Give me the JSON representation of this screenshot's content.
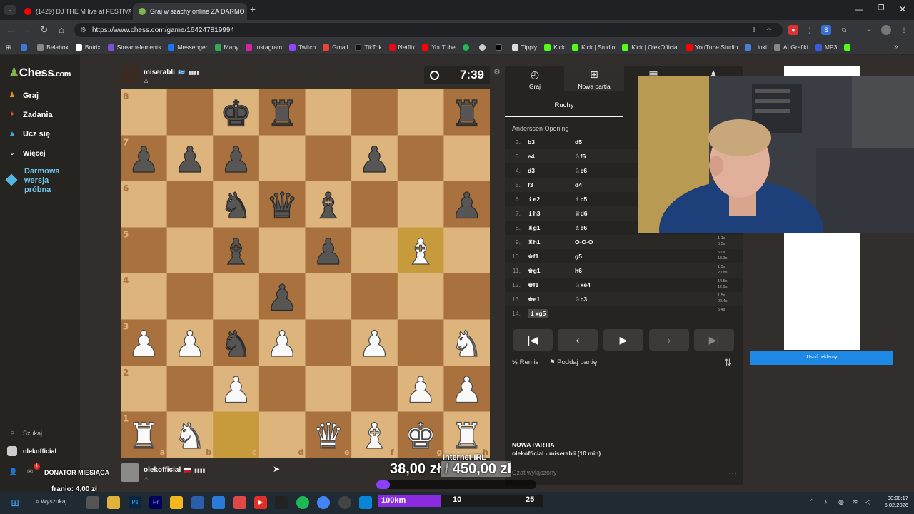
{
  "browser": {
    "tabs": [
      {
        "title": "(1429) DJ THE M live at FESTIVA",
        "favicon_color": "#ff0000"
      },
      {
        "title": "Graj w szachy online ZA DARMO",
        "favicon_color": "#81b64c"
      }
    ],
    "url": "https://www.chess.com/game/164247819994",
    "bookmarks": [
      "Belabox",
      "Botrix",
      "Streamelements",
      "Messenger",
      "Mapy",
      "Instagram",
      "Twitch",
      "Gmail",
      "TikTok",
      "Netflix",
      "YouTube",
      "",
      "",
      "",
      "Tipply",
      "Kick",
      "Kick | Studio",
      "Kick | OlekOfficial",
      "YouTube Studio",
      "Linki",
      "AI Grafiki",
      "MP3",
      ""
    ]
  },
  "sidebar": {
    "logo_text": "Chess",
    "logo_suffix": ".com",
    "items": [
      {
        "label": "Graj",
        "icon": "play-icon",
        "color": "#e6912c"
      },
      {
        "label": "Zadania",
        "icon": "puzzle-icon",
        "color": "#e05a2b"
      },
      {
        "label": "Ucz się",
        "icon": "learn-icon",
        "color": "#45a7df"
      },
      {
        "label": "Więcej",
        "icon": "chevron-down-icon",
        "color": "#ffffff"
      }
    ],
    "trial": "Darmowa wersja próbna",
    "search": "Szukaj",
    "user": "olekofficial"
  },
  "top_player": {
    "name": "miserabli",
    "flag": "🇬🇷",
    "bars": "▮▮▮▮",
    "clock": "7:39"
  },
  "bottom_player": {
    "name": "olekofficial",
    "flag": "🇵🇱",
    "bars": "▮▮▮▮"
  },
  "board": {
    "light": "#dcb47c",
    "dark": "#a8713d",
    "highlight_light": "#f4d04e",
    "highlight_dark": "#c79a3b",
    "highlighted_squares": [
      "g5",
      "c1"
    ],
    "pieces": {
      "c8": "bK",
      "d8": "bR",
      "h8": "bR",
      "a7": "bP",
      "b7": "bP",
      "c7": "bP",
      "f7": "bP",
      "c6": "bN",
      "d6": "bQ",
      "e6": "bB",
      "h6": "bP",
      "c5": "bB",
      "e5": "bP",
      "g5": "wB",
      "d4": "bP",
      "a3": "wP",
      "b3": "wP",
      "c3": "bN",
      "d3": "wP",
      "f3": "wP",
      "h3": "wN",
      "c2": "wP",
      "g2": "wP",
      "h2": "wP",
      "a1": "wR",
      "b1": "wN",
      "e1": "wQ",
      "f1": "wB",
      "g1": "wK",
      "h1": "wR"
    },
    "files": [
      "a",
      "b",
      "c",
      "d",
      "e",
      "f",
      "g",
      "h"
    ],
    "ranks": [
      "8",
      "7",
      "6",
      "5",
      "4",
      "3",
      "2",
      "1"
    ]
  },
  "panel": {
    "tabs": [
      {
        "label": "Graj",
        "icon": "clock-icon"
      },
      {
        "label": "Nowa partia",
        "icon": "plus-icon"
      },
      {
        "label": "",
        "icon": "board-icon"
      },
      {
        "label": "",
        "icon": "players-icon"
      }
    ],
    "moves_tab": "Ruchy",
    "opening": "Anderssen Opening",
    "moves": [
      {
        "n": "2.",
        "w": "b3",
        "b": "d5",
        "t1": "",
        "t2": ""
      },
      {
        "n": "3.",
        "w": "e4",
        "b": "♘f6",
        "t1": "",
        "t2": ""
      },
      {
        "n": "4.",
        "w": "d3",
        "b": "♘c6",
        "t1": "",
        "t2": ""
      },
      {
        "n": "5.",
        "w": "f3",
        "b": "d4",
        "t1": "",
        "t2": ""
      },
      {
        "n": "6.",
        "w": "♝e2",
        "b": "♗c5",
        "t1": "",
        "t2": ""
      },
      {
        "n": "7.",
        "w": "♝h3",
        "b": "♕d6",
        "t1": "",
        "t2": ""
      },
      {
        "n": "8.",
        "w": "♜g1",
        "b": "♗e6",
        "t1": "",
        "t2": ""
      },
      {
        "n": "9.",
        "w": "♜h1",
        "b": "O-O-O",
        "t1": "1.1s",
        "t2": "5.3s"
      },
      {
        "n": "10.",
        "w": "♚f1",
        "b": "g5",
        "t1": "5.0s",
        "t2": "13.3s"
      },
      {
        "n": "11.",
        "w": "♚g1",
        "b": "h6",
        "t1": "1.5s",
        "t2": "20.8s"
      },
      {
        "n": "12.",
        "w": "♚f1",
        "b": "♘xe4",
        "t1": "14.5s",
        "t2": "12.9s"
      },
      {
        "n": "13.",
        "w": "♚e1",
        "b": "♘c3",
        "t1": "1.5s",
        "t2": "22.4s"
      },
      {
        "n": "14.",
        "w": "♝xg5",
        "b": "",
        "t1": "5.4s",
        "t2": ""
      }
    ],
    "draw": "Remis",
    "resign": "Poddaj partię",
    "new_game_title": "NOWA PARTIA",
    "new_game_desc": "olekofficial - miserabli (10 min)",
    "chat_placeholder": "Czat wyłączony"
  },
  "ads": {
    "remove": "Usuń reklamy"
  },
  "overlay": {
    "donator_label": "DONATOR MIESIĄCA",
    "donator_value": "franio: 4,00 zł",
    "goal_title": "Internet IRL",
    "goal_current": "38,00 zł",
    "goal_separator": " / ",
    "goal_target": "450,00 zł",
    "goal_progress": 0.084,
    "km_label": "100km",
    "km_a": "10",
    "km_b": "25"
  },
  "taskbar": {
    "search": "Wyszukaj",
    "time": "00:00:17",
    "date": "5.02.2026"
  }
}
